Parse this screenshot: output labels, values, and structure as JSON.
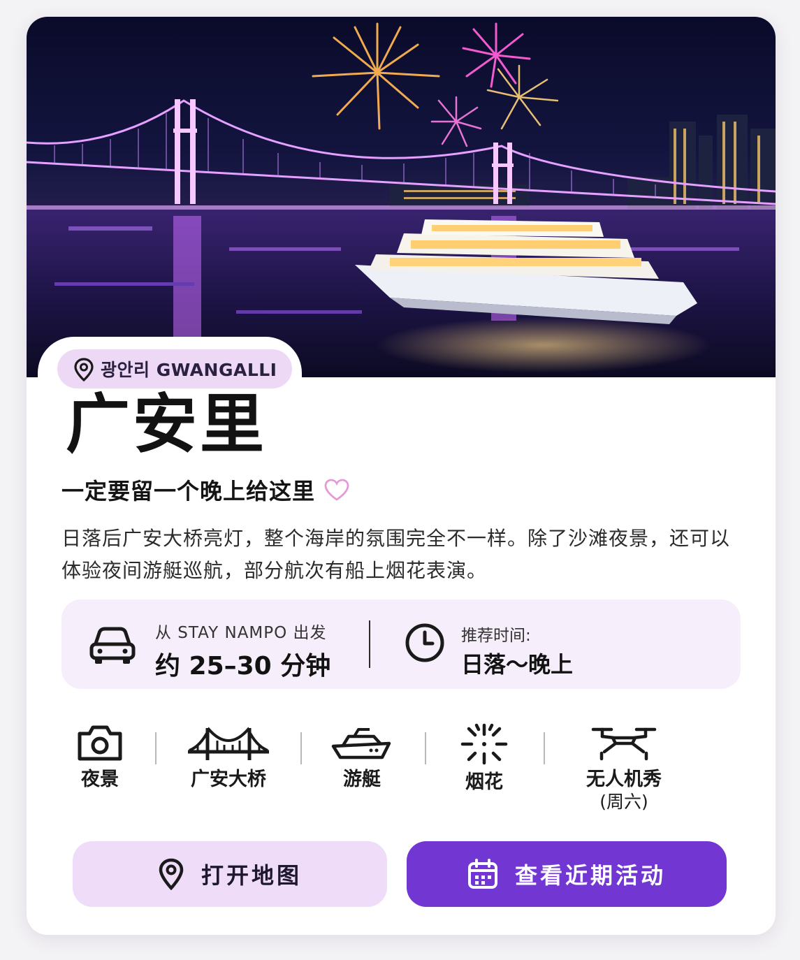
{
  "location": {
    "tag": "광안리 GWANGALLI"
  },
  "title": "广安里",
  "subtitle": "一定要留一个晚上给这里",
  "description": "日落后广安大桥亮灯，整个海岸的氛围完全不一样。除了沙滩夜景，还可以体验夜间游艇巡航，部分航次有船上烟花表演。",
  "info": {
    "from_label": "从 STAY NAMPO 出发",
    "duration": "约 25–30 分钟",
    "recommend_label": "推荐时间:",
    "recommend_value": "日落～晚上"
  },
  "features": [
    {
      "label": "夜景",
      "icon": "camera-icon"
    },
    {
      "label": "广安大桥",
      "icon": "bridge-icon"
    },
    {
      "label": "游艇",
      "icon": "yacht-icon"
    },
    {
      "label": "烟花",
      "icon": "fireworks-icon"
    },
    {
      "label": "无人机秀",
      "sub": "(周六)",
      "icon": "drone-icon"
    }
  ],
  "buttons": {
    "map": "打开地图",
    "events": "查看近期活动"
  },
  "colors": {
    "accent": "#7236d3",
    "pill": "#edd9f6",
    "info_bg": "#f6eefa",
    "heart": "#e59ad8"
  }
}
